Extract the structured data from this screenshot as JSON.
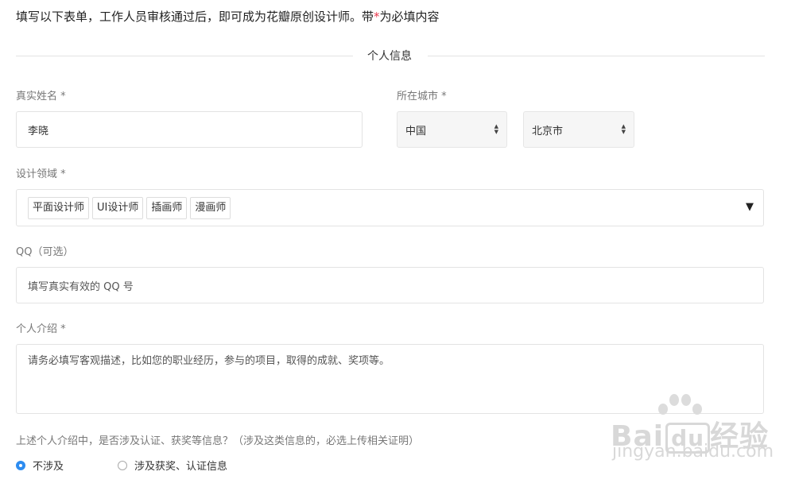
{
  "intro": {
    "text_before": "填写以下表单，工作人员审核通过后，即可成为花瓣原创设计师。带",
    "asterisk": "*",
    "text_after": "为必填内容"
  },
  "section": {
    "title": "个人信息"
  },
  "name_field": {
    "label": "真实姓名 *",
    "value": "李晓"
  },
  "city_field": {
    "label": "所在城市 *",
    "country": "中国",
    "city": "北京市"
  },
  "design_field": {
    "label": "设计领域 *",
    "tags": [
      "平面设计师",
      "UI设计师",
      "插画师",
      "漫画师"
    ],
    "dropdown_glyph": "▼"
  },
  "qq_field": {
    "label": "QQ（可选）",
    "placeholder": "填写真实有效的 QQ 号"
  },
  "intro_field": {
    "label": "个人介绍 *",
    "placeholder": "请务必填写客观描述，比如您的职业经历，参与的项目，取得的成就、奖项等。"
  },
  "cert_question": {
    "label": "上述个人介绍中，是否涉及认证、获奖等信息？（涉及这类信息的，必选上传相关证明）",
    "options": [
      {
        "label": "不涉及",
        "checked": true
      },
      {
        "label": "涉及获奖、认证信息",
        "checked": false
      }
    ]
  },
  "watermark": {
    "brand_a": "Bai",
    "brand_b": "du",
    "brand_c": "经验",
    "url": "jingyan.baidu.com"
  },
  "colors": {
    "required": "#e8384d",
    "accent": "#2d8cf0",
    "border": "#e3e3e3",
    "label": "#777777"
  },
  "icons": [
    "up-down-arrows-icon",
    "dropdown-triangle-icon",
    "radio-icon",
    "paw-logo-icon"
  ]
}
